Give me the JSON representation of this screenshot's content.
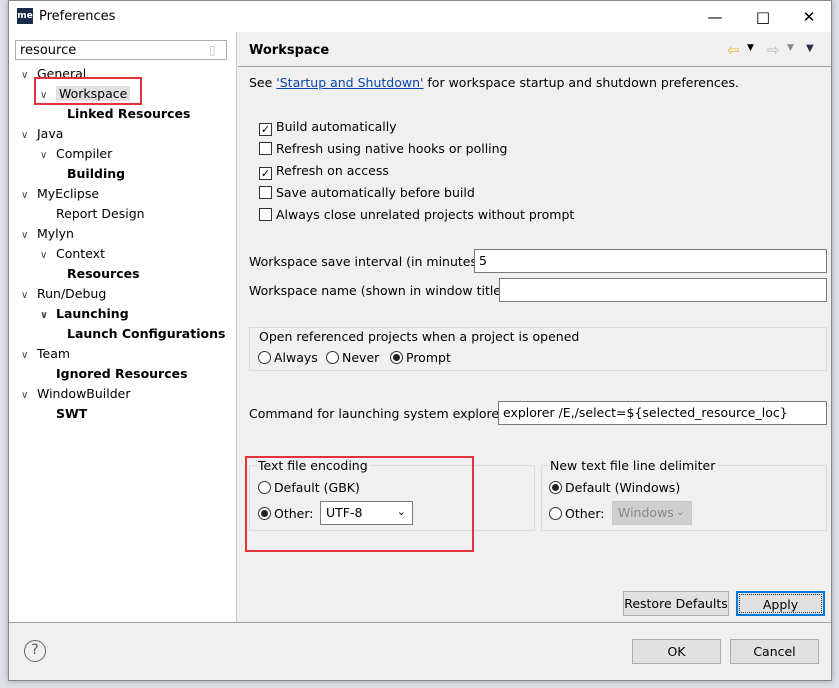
{
  "window": {
    "title": "Preferences",
    "logo": "me",
    "controls": [
      "minimize-icon",
      "maximize-icon",
      "close-icon"
    ]
  },
  "filter": {
    "value": "resource",
    "clear_icon": "eraser-icon"
  },
  "tree": [
    {
      "label": "General",
      "level": 0,
      "expanded": true
    },
    {
      "label": "Workspace",
      "level": 1,
      "expanded": true,
      "selected": true
    },
    {
      "label": "Linked Resources",
      "level": 2,
      "bold": true
    },
    {
      "label": "Java",
      "level": 0,
      "expanded": true
    },
    {
      "label": "Compiler",
      "level": 1,
      "expanded": true
    },
    {
      "label": "Building",
      "level": 2,
      "bold": true
    },
    {
      "label": "MyEclipse",
      "level": 0,
      "expanded": true
    },
    {
      "label": "Report Design",
      "level": 1
    },
    {
      "label": "Mylyn",
      "level": 0,
      "expanded": true
    },
    {
      "label": "Context",
      "level": 1,
      "expanded": true
    },
    {
      "label": "Resources",
      "level": 2,
      "bold": true
    },
    {
      "label": "Run/Debug",
      "level": 0,
      "expanded": true
    },
    {
      "label": "Launching",
      "level": 1,
      "expanded": true,
      "bold": true
    },
    {
      "label": "Launch Configurations",
      "level": 2,
      "bold": true
    },
    {
      "label": "Team",
      "level": 0,
      "expanded": true
    },
    {
      "label": "Ignored Resources",
      "level": 1,
      "bold": true
    },
    {
      "label": "WindowBuilder",
      "level": 0,
      "expanded": true
    },
    {
      "label": "SWT",
      "level": 1,
      "bold": true
    }
  ],
  "page": {
    "title": "Workspace",
    "intro_pre": "See ",
    "intro_link": "'Startup and Shutdown'",
    "intro_post": " for workspace startup and shutdown preferences.",
    "checkboxes": [
      {
        "label": "Build automatically",
        "checked": true
      },
      {
        "label": "Refresh using native hooks or polling",
        "checked": false
      },
      {
        "label": "Refresh on access",
        "checked": true
      },
      {
        "label": "Save automatically before build",
        "checked": false
      },
      {
        "label": "Always close unrelated projects without prompt",
        "checked": false
      }
    ],
    "save_interval_label": "Workspace save interval (in minutes):",
    "save_interval_value": "5",
    "name_label": "Workspace name (shown in window title):",
    "name_value": "",
    "open_ref_label": "Open referenced projects when a project is opened",
    "open_ref_options": [
      "Always",
      "Never",
      "Prompt"
    ],
    "open_ref_selected": "Prompt",
    "explorer_label": "Command for launching system explorer:",
    "explorer_value": "explorer /E,/select=${selected_resource_loc}",
    "encoding": {
      "label": "Text file encoding",
      "default_label": "Default (GBK)",
      "other_label": "Other:",
      "selected": "Other",
      "value": "UTF-8"
    },
    "delimiter": {
      "label": "New text file line delimiter",
      "default_label": "Default (Windows)",
      "other_label": "Other:",
      "selected": "Default",
      "value": "Windows"
    },
    "restore_label": "Restore Defaults",
    "apply_label": "Apply"
  },
  "footer": {
    "ok_label": "OK",
    "cancel_label": "Cancel",
    "help_icon": "help-icon"
  },
  "colors": {
    "highlight": "#e5323a",
    "link": "#0645ad"
  }
}
